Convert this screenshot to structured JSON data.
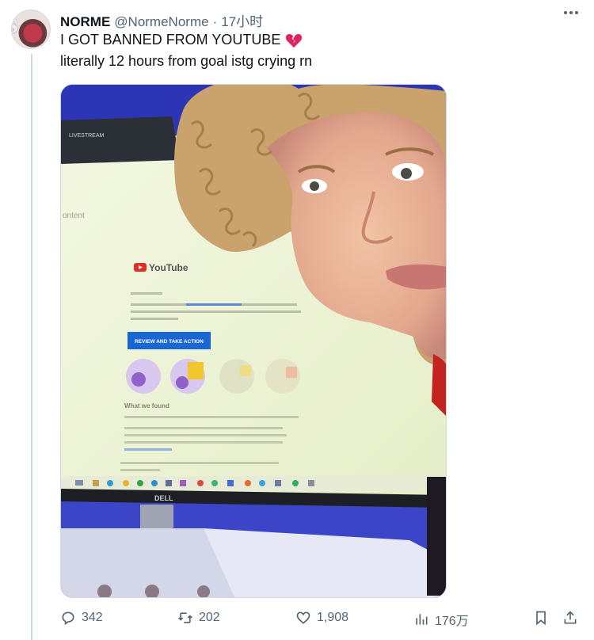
{
  "tweet": {
    "display_name": "NORME",
    "handle": "@NormeNorme",
    "separator": "·",
    "time": "17小时",
    "text_line1": "I GOT BANNED FROM YOUTUBE",
    "text_line2": "literally 12 hours from goal istg crying rn"
  },
  "media": {
    "monitor_brand": "DELL",
    "email_logo": "YouTube",
    "email_button": "REVIEW AND TAKE ACTION",
    "email_section": "What we found",
    "email_sidebar_label": "ontent",
    "window_tab": "LIVESTREAM"
  },
  "actions": {
    "replies": "342",
    "reposts": "202",
    "likes": "1,908",
    "views": "176万"
  },
  "colors": {
    "accent_text": "#536471",
    "broken_heart": "#e0245e"
  }
}
